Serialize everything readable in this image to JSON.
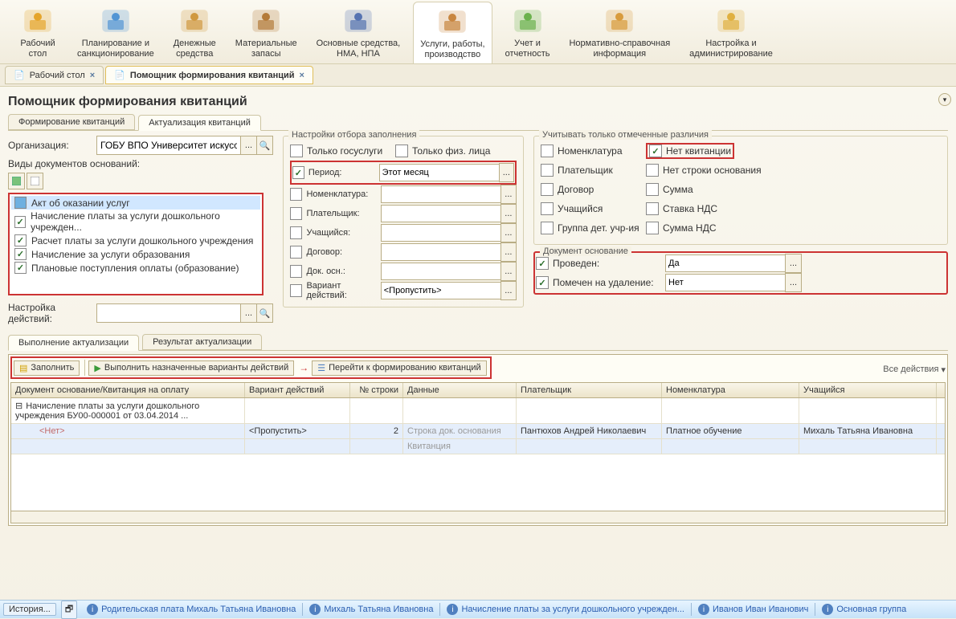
{
  "ribbon": [
    {
      "label": "Рабочий\nстол",
      "color": "#e5a52c"
    },
    {
      "label": "Планирование и\nсанкционирование",
      "color": "#5295d4"
    },
    {
      "label": "Денежные\nсредства",
      "color": "#d09940"
    },
    {
      "label": "Материальные\nзапасы",
      "color": "#b47b3a"
    },
    {
      "label": "Основные средства,\nНМА, НПА",
      "color": "#5673b1"
    },
    {
      "label": "Услуги, работы,\nпроизводство",
      "active": true,
      "color": "#c88640"
    },
    {
      "label": "Учет и\nотчетность",
      "color": "#6bb24e"
    },
    {
      "label": "Нормативно-справочная\nинформация",
      "color": "#d89b3c"
    },
    {
      "label": "Настройка и\nадминистрирование",
      "color": "#e0b040"
    }
  ],
  "tabs": [
    {
      "label": "Рабочий стол"
    },
    {
      "label": "Помощник формирования квитанций",
      "active": true
    }
  ],
  "page_title": "Помощник формирования квитанций",
  "subtabs": [
    "Формирование квитанций",
    "Актуализация квитанций"
  ],
  "org_label": "Организация:",
  "org_value": "ГОБУ ВПО Университет искусств",
  "doc_types_label": "Виды документов оснований:",
  "doc_types": [
    {
      "label": "Акт об оказании услуг",
      "checked": false,
      "sel": true
    },
    {
      "label": "Начисление платы за услуги дошкольного учрежден...",
      "checked": true
    },
    {
      "label": "Расчет платы за услуги дошкольного учреждения",
      "checked": true
    },
    {
      "label": "Начисление за услуги образования",
      "checked": true
    },
    {
      "label": "Плановые поступления оплаты (образование)",
      "checked": true
    }
  ],
  "settings_label": "Настройка действий:",
  "filter_title": "Настройки отбора заполнения",
  "filter": {
    "gosuslugi": "Только госуслуги",
    "fizlica": "Только физ. лица",
    "period_lbl": "Период:",
    "period_val": "Этот месяц",
    "nomen_lbl": "Номенклатура:",
    "plat_lbl": "Плательщик:",
    "uch_lbl": "Учащийся:",
    "dog_lbl": "Договор:",
    "docosn_lbl": "Док. осн.:",
    "variant_lbl": "Вариант действий:",
    "variant_val": "<Пропустить>"
  },
  "diff_title": "Учитывать только отмеченные различия",
  "diff": {
    "nomen": "Номенклатура",
    "nokvit": "Нет квитанции",
    "plat": "Плательщик",
    "nostr": "Нет строки основания",
    "dog": "Договор",
    "summa": "Сумма",
    "uch": "Учащийся",
    "nds": "Ставка НДС",
    "grp": "Группа дет. учр-ия",
    "sndc": "Сумма НДС"
  },
  "docbase_title": "Документ основание",
  "docbase": {
    "prov_lbl": "Проведен:",
    "prov_val": "Да",
    "del_lbl": "Помечен на удаление:",
    "del_val": "Нет"
  },
  "subtabs2": [
    "Выполнение актуализации",
    "Результат актуализации"
  ],
  "actions": {
    "zapolnit": "Заполнить",
    "vypolnit": "Выполнить назначенные варианты действий",
    "pereiti": "Перейти к формированию квитанций",
    "all": "Все действия"
  },
  "grid_head": [
    "Документ основание/Квитанция на оплату",
    "Вариант действий",
    "№ строки",
    "Данные",
    "Плательщик",
    "Номенклатура",
    "Учащийся"
  ],
  "grid_rows": [
    {
      "c1": "Начисление платы за услуги дошкольного учреждения БУ00-000001 от 03.04.2014 ..."
    },
    {
      "c1": "<Нет>",
      "c2": "<Пропустить>",
      "c3": "2",
      "c4": "Строка док. основания",
      "c5": "Пантюхов Андрей Николаевич",
      "c6": "Платное обучение",
      "c7": "Михаль Татьяна Ивановна",
      "sel": true,
      "link": true
    },
    {
      "c4": "Квитанция",
      "sel": true
    }
  ],
  "status": {
    "history": "История...",
    "links": [
      "Родительская плата Михаль Татьяна Ивановна",
      "Михаль Татьяна Ивановна",
      "Начисление платы за услуги дошкольного учрежден...",
      "Иванов Иван Иванович",
      "Основная группа"
    ]
  }
}
